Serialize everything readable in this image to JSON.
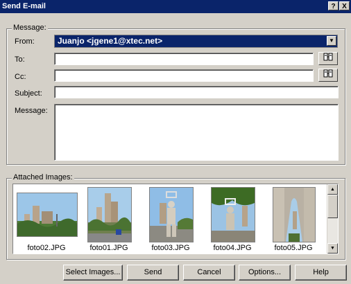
{
  "window": {
    "title": "Send E-mail",
    "help_label": "?",
    "close_label": "X"
  },
  "message_group": {
    "label": "Message:",
    "from_label": "From:",
    "from_value": "Juanjo <jgene1@xtec.net>",
    "to_label": "To:",
    "to_value": "",
    "cc_label": "Cc:",
    "cc_value": "",
    "subject_label": "Subject:",
    "subject_value": "",
    "message_label": "Message:",
    "message_value": ""
  },
  "attachments": {
    "label": "Attached Images:",
    "items": [
      {
        "name": "foto02.JPG"
      },
      {
        "name": "foto01.JPG"
      },
      {
        "name": "foto03.JPG"
      },
      {
        "name": "foto04.JPG"
      },
      {
        "name": "foto05.JPG"
      }
    ]
  },
  "buttons": {
    "select_images": "Select Images...",
    "send": "Send",
    "cancel": "Cancel",
    "options": "Options...",
    "help": "Help"
  },
  "icons": {
    "address_book": "address-book-icon",
    "dropdown": "chevron-down-icon"
  }
}
